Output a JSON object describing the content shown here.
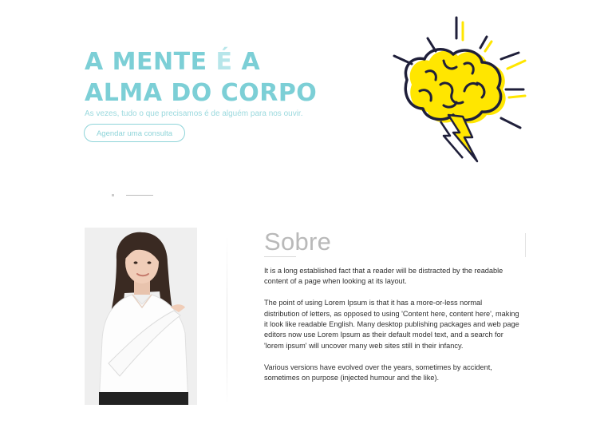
{
  "hero": {
    "title_line1_part1": "A MENTE ",
    "title_line1_accent": "É",
    "title_line1_part2": " A",
    "title_line2": "ALMA DO CORPO",
    "subtitle": "As vezes, tudo o que precisamos é de alguém para nos ouvir.",
    "cta_label": "Agendar uma consulta",
    "illustration": "brain-lightning-icon"
  },
  "about": {
    "title": "Sobre",
    "photo": "woman-pointing-photo",
    "paragraphs": [
      "It is a long established fact that a reader will be distracted by the readable content of a page when looking at its layout.",
      "The point of using Lorem Ipsum is that it has a more-or-less normal distribution of letters, as opposed to using 'Content here, content here', making it look like readable English. Many desktop publishing packages and web page editors now use Lorem Ipsum as their default model text, and a search for 'lorem ipsum' will uncover many web sites still in their infancy.",
      "Various versions have evolved over the years, sometimes by accident, sometimes on purpose (injected humour and the like)."
    ]
  },
  "colors": {
    "accent": "#7ccfd6",
    "accent_light": "#b7e6ea",
    "brain_yellow": "#ffe600",
    "ink": "#1f1f3a"
  }
}
